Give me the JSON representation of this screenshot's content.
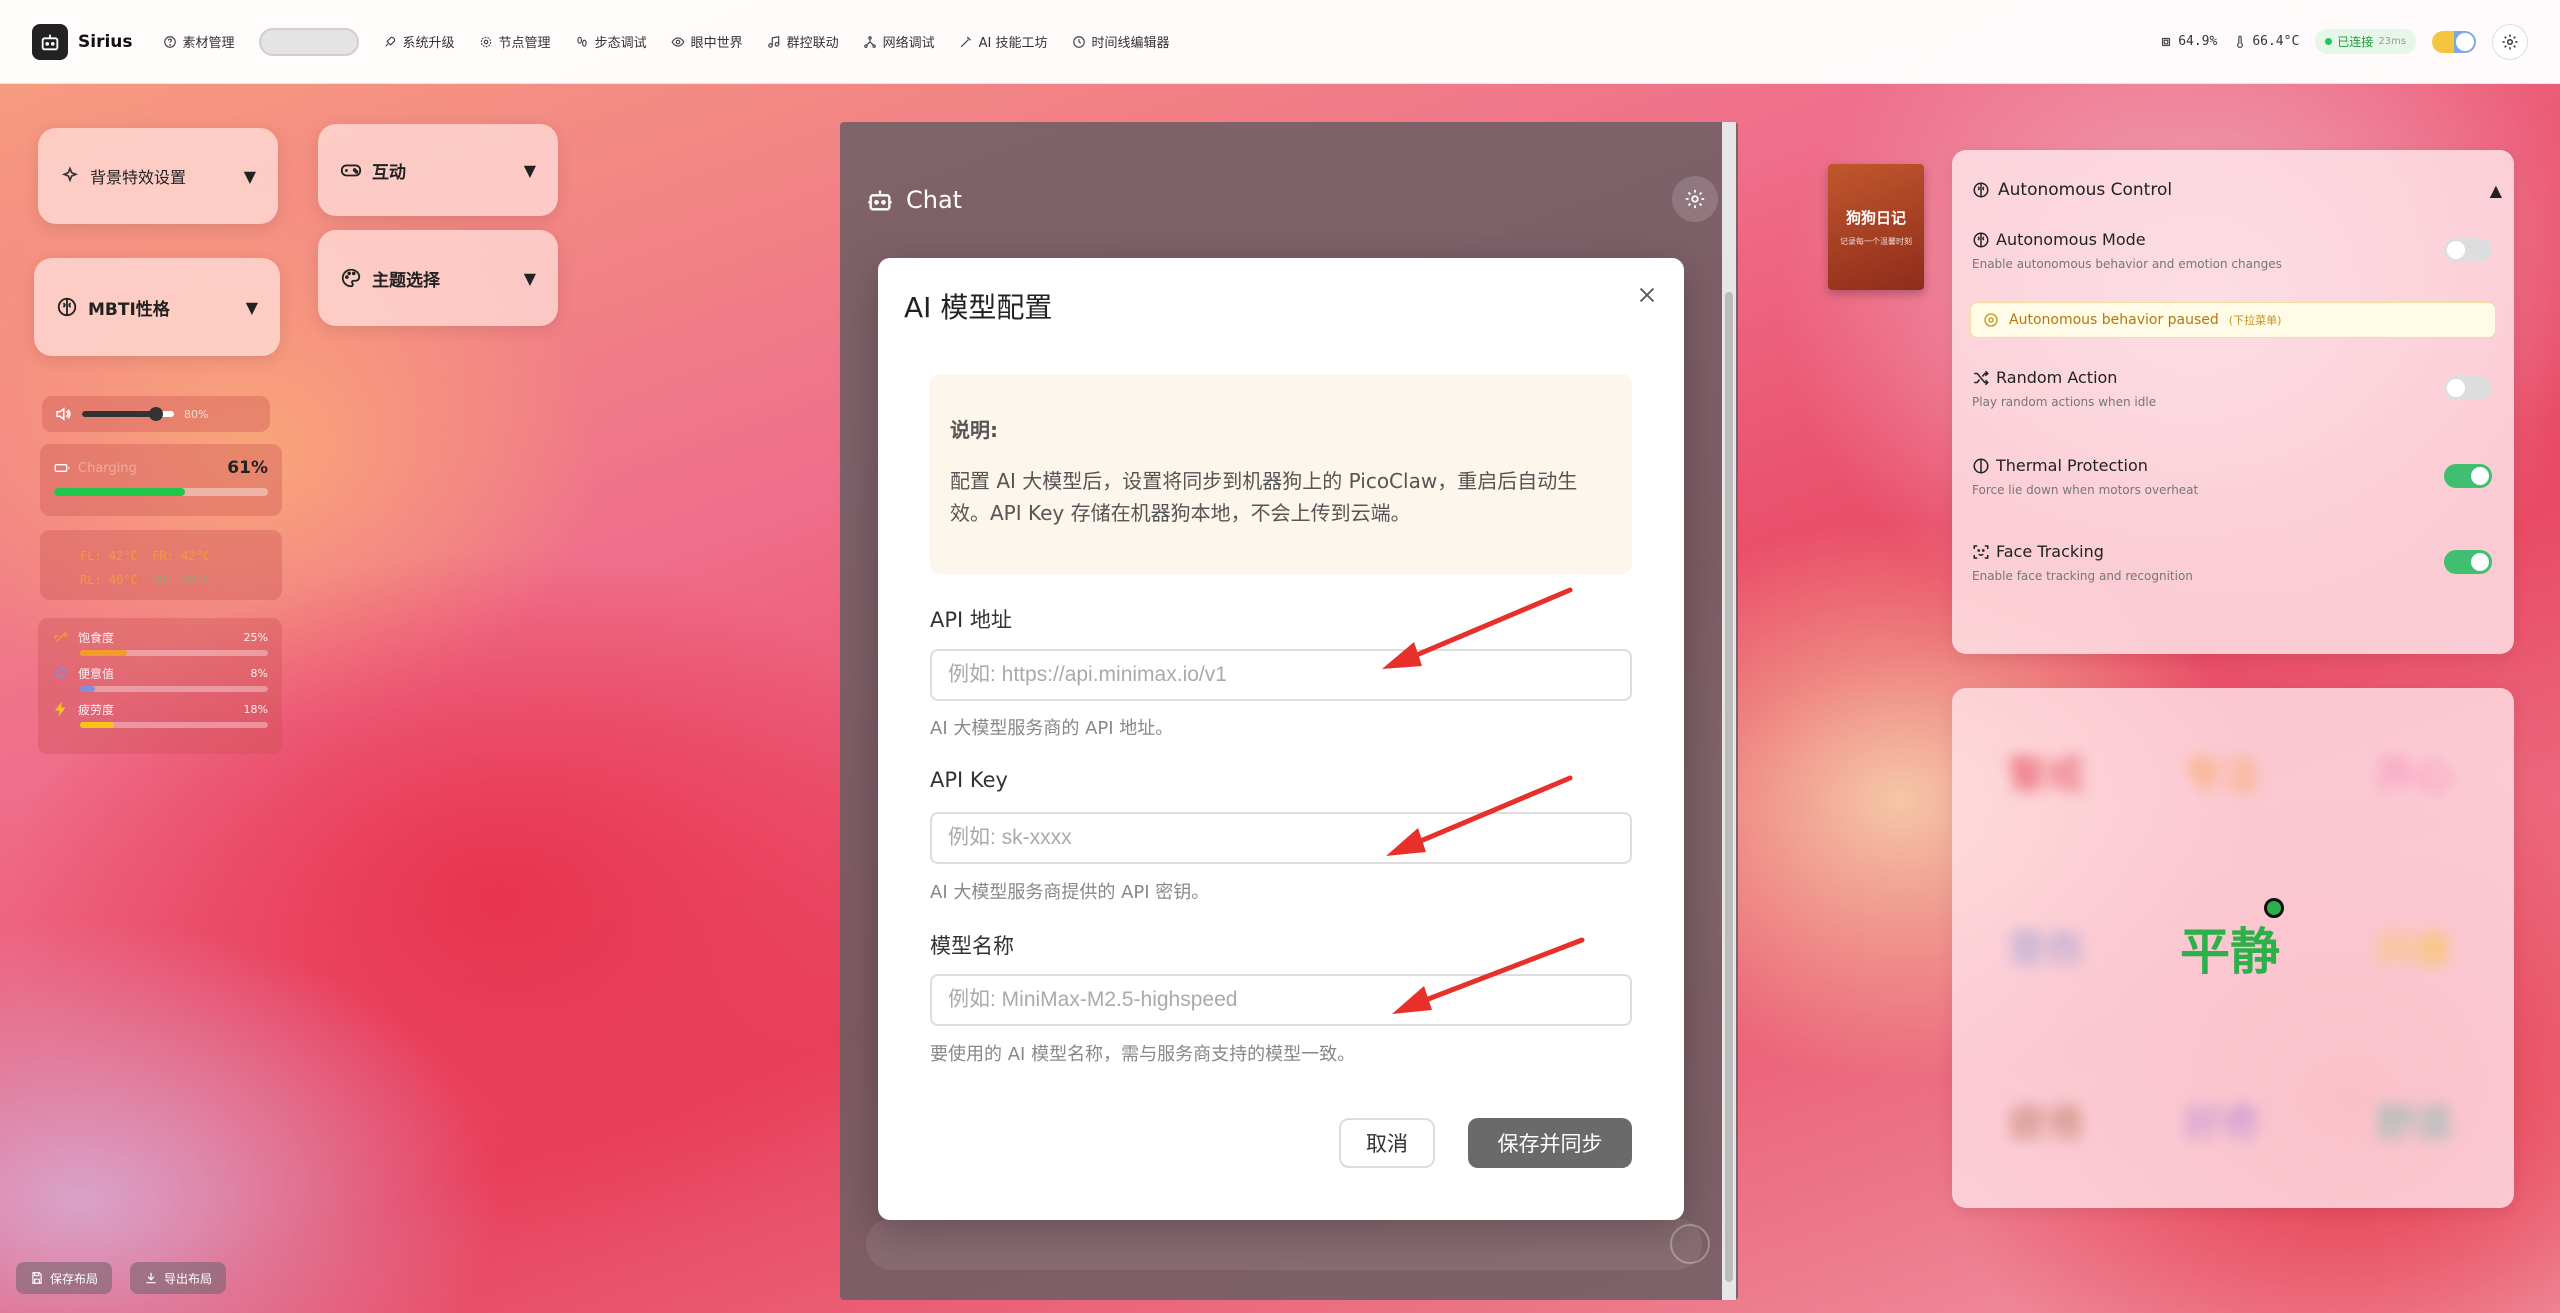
{
  "app": {
    "name": "Sirius"
  },
  "nav": [
    {
      "label": "素材管理",
      "icon": "help-circle-icon"
    },
    {
      "label": "",
      "icon": "",
      "active": true
    },
    {
      "label": "系统升级",
      "icon": "rocket-icon"
    },
    {
      "label": "节点管理",
      "icon": "gear-icon"
    },
    {
      "label": "步态调试",
      "icon": "footprints-icon"
    },
    {
      "label": "眼中世界",
      "icon": "eye-icon"
    },
    {
      "label": "群控联动",
      "icon": "music-icon"
    },
    {
      "label": "网络调试",
      "icon": "network-icon"
    },
    {
      "label": "AI 技能工坊",
      "icon": "wand-icon"
    },
    {
      "label": "时间线编辑器",
      "icon": "clock-icon"
    }
  ],
  "status": {
    "cpu": "64.9%",
    "temp": "66.4°C",
    "connection": "已连接",
    "latency": "23ms"
  },
  "left": {
    "bg_effects": "背景特效设置",
    "interaction": "互动",
    "mbti": "MBTI性格",
    "theme": "主题选择",
    "volume": {
      "value": "80%",
      "level": 0.8
    },
    "battery": {
      "label": "Charging",
      "pct": "61%",
      "level": 0.61
    },
    "temps": {
      "fl": "FL: 42°C",
      "fr": "FR: 42°C",
      "rl": "RL: 40°C",
      "rr": "RR: 39°C"
    },
    "needs": [
      {
        "label": "饱食度",
        "value": "25%",
        "level": 0.25,
        "color": "#f39c2b"
      },
      {
        "label": "便意值",
        "value": "8%",
        "level": 0.08,
        "color": "#7f8fd9"
      },
      {
        "label": "疲劳度",
        "value": "18%",
        "level": 0.18,
        "color": "#f5c518"
      }
    ],
    "save_layout": "保存布局",
    "export_layout": "导出布局"
  },
  "chat": {
    "title": "Chat"
  },
  "modal": {
    "title": "AI 模型配置",
    "note_head": "说明:",
    "note_body": "配置 AI 大模型后，设置将同步到机器狗上的 PicoClaw，重启后自动生效。API Key 存储在机器狗本地，不会上传到云端。",
    "api_url": {
      "label": "API 地址",
      "placeholder": "例如: https://api.minimax.io/v1",
      "hint": "AI 大模型服务商的 API 地址。"
    },
    "api_key": {
      "label": "API Key",
      "placeholder": "例如: sk-xxxx",
      "hint": "AI 大模型服务商提供的 API 密钥。"
    },
    "model_name": {
      "label": "模型名称",
      "placeholder": "例如: MiniMax-M2.5-highspeed",
      "hint": "要使用的 AI 模型名称，需与服务商支持的模型一致。"
    },
    "cancel": "取消",
    "save": "保存并同步"
  },
  "diary": {
    "title": "狗狗日记",
    "subtitle": "记录每一个温馨时刻"
  },
  "autonomous": {
    "title": "Autonomous Control",
    "mode": {
      "name": "Autonomous Mode",
      "desc": "Enable autonomous behavior and emotion changes",
      "on": false
    },
    "paused": "Autonomous behavior paused",
    "paused_note": "(下拉菜单)",
    "random": {
      "name": "Random Action",
      "desc": "Play random actions when idle",
      "on": false
    },
    "thermal": {
      "name": "Thermal Protection",
      "desc": "Force lie down when motors overheat",
      "on": true
    },
    "face": {
      "name": "Face Tracking",
      "desc": "Enable face tracking and recognition",
      "on": true
    }
  },
  "emotions": {
    "current": "平静",
    "grid": [
      "警戒",
      "专注",
      "开心",
      "悲伤",
      "兴奋",
      "疲倦",
      "好奇",
      "舒适"
    ]
  }
}
